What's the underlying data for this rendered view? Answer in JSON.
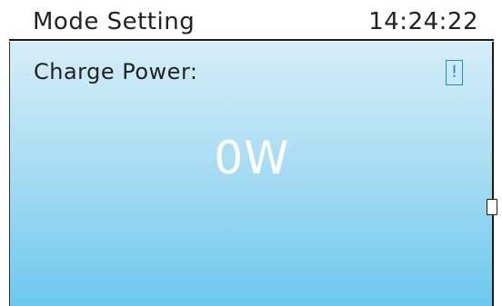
{
  "header": {
    "title": "Mode Setting",
    "time": "14:24:22"
  },
  "main": {
    "field_label": "Charge Power:",
    "alert_glyph": "!",
    "value": "0W"
  },
  "colors": {
    "gradient_top": "#d6eef9",
    "gradient_bottom": "#6cc8ef",
    "alert_accent": "#1b8fd6",
    "value_text": "#ffffff"
  },
  "icons": {
    "alert": "exclamation-icon"
  }
}
